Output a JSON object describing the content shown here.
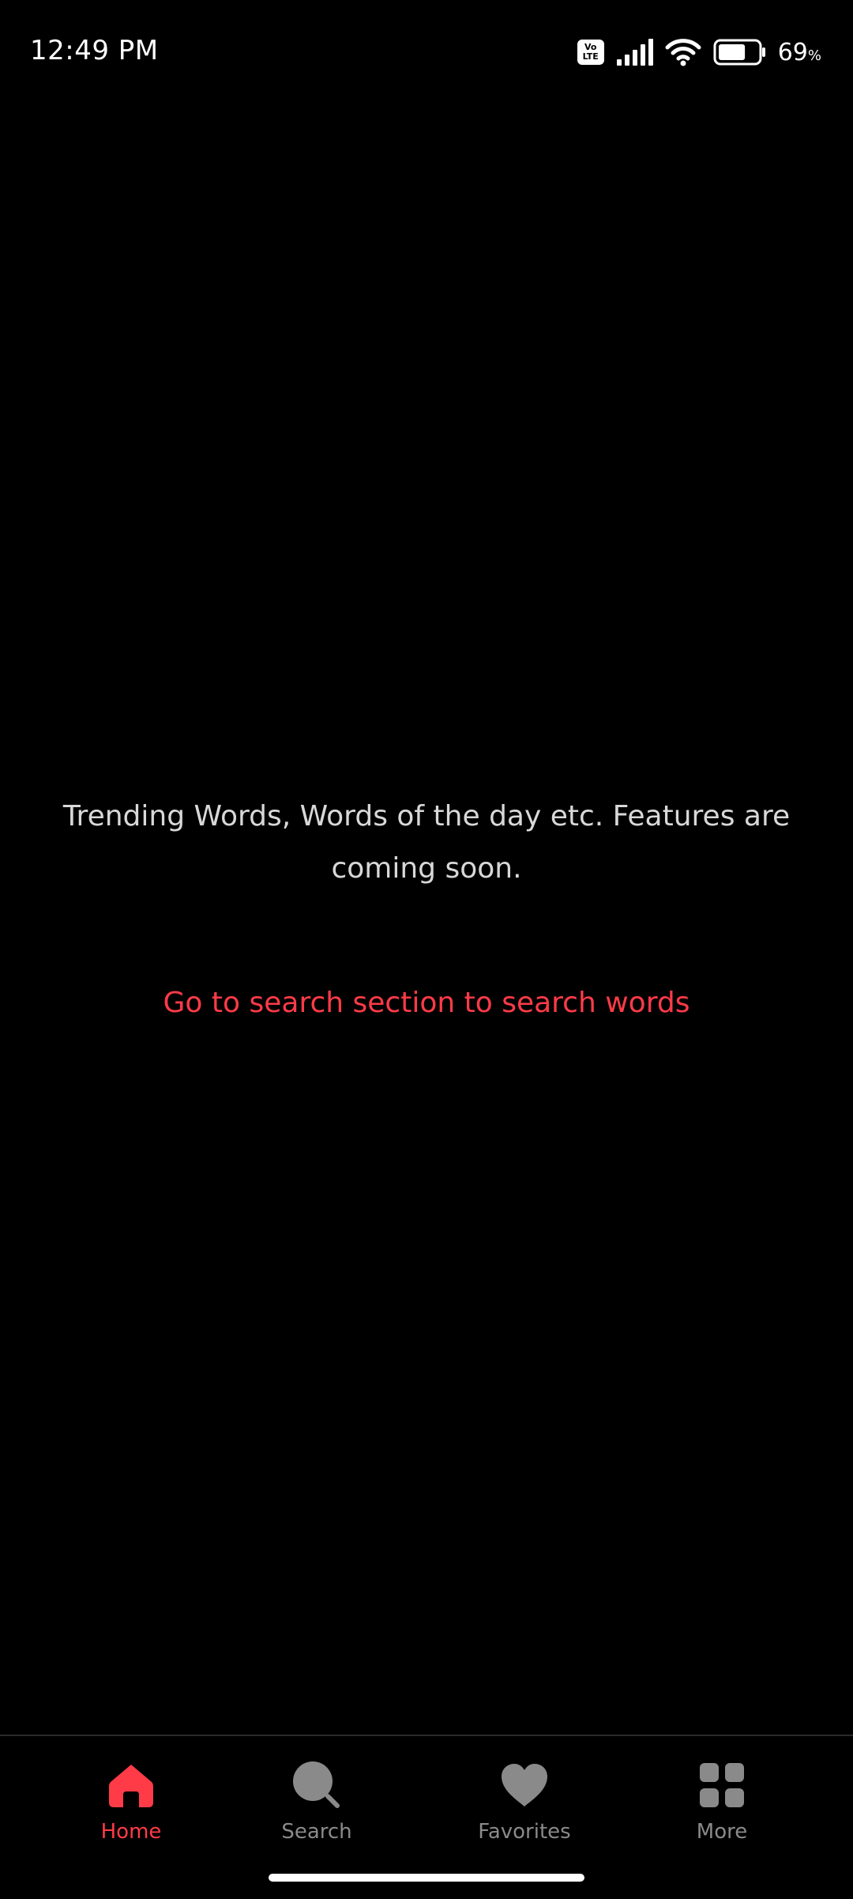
{
  "status_bar": {
    "time": "12:49 PM",
    "volte_top": "Vo",
    "volte_bottom": "LTE",
    "battery_percent": "69",
    "battery_unit": "%",
    "battery_level": 0.69
  },
  "main": {
    "message": "Trending Words, Words of the day etc. Features are coming soon.",
    "search_link": "Go to search section to search words"
  },
  "bottom_nav": {
    "items": [
      {
        "label": "Home",
        "icon": "home-icon",
        "active": true
      },
      {
        "label": "Search",
        "icon": "search-icon",
        "active": false
      },
      {
        "label": "Favorites",
        "icon": "heart-icon",
        "active": false
      },
      {
        "label": "More",
        "icon": "grid-icon",
        "active": false
      }
    ]
  },
  "colors": {
    "accent": "#ff3b48",
    "background": "#000000",
    "inactive": "#8a8a8a",
    "text": "#d8d8d8"
  }
}
